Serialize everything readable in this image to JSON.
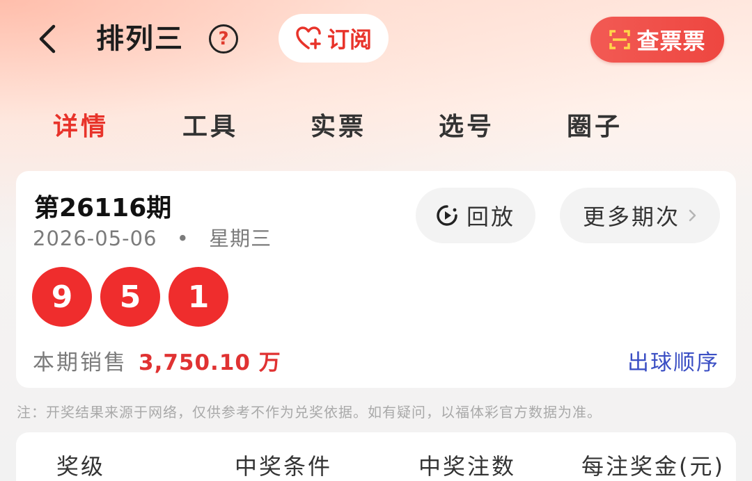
{
  "header": {
    "title": "排列三",
    "help_glyph": "?",
    "subscribe_label": "订阅",
    "check_ticket_label": "查票票"
  },
  "tabs": [
    {
      "label": "详情",
      "active": true
    },
    {
      "label": "工具",
      "active": false
    },
    {
      "label": "实票",
      "active": false
    },
    {
      "label": "选号",
      "active": false
    },
    {
      "label": "圈子",
      "active": false
    }
  ],
  "draw": {
    "issue": "第26116期",
    "date": "2026-05-06",
    "separator": "•",
    "weekday": "星期三",
    "replay_label": "回放",
    "more_label": "更多期次",
    "balls": [
      "9",
      "5",
      "1"
    ],
    "sales_label": "本期销售",
    "sales_value": "3,750.10 万",
    "order_link": "出球顺序"
  },
  "note": "注：开奖结果来源于网络，仅供参考不作为兑奖依据。如有疑问，以福体彩官方数据为准。",
  "prize_table": {
    "headers": [
      "奖级",
      "中奖条件",
      "中奖注数",
      "每注奖金(元)"
    ]
  },
  "colors": {
    "accent_red": "#e8332a",
    "ball_red": "#ef2d2d",
    "link_blue": "#3b4fc4",
    "check_ticket_bg": "#f25a54"
  }
}
